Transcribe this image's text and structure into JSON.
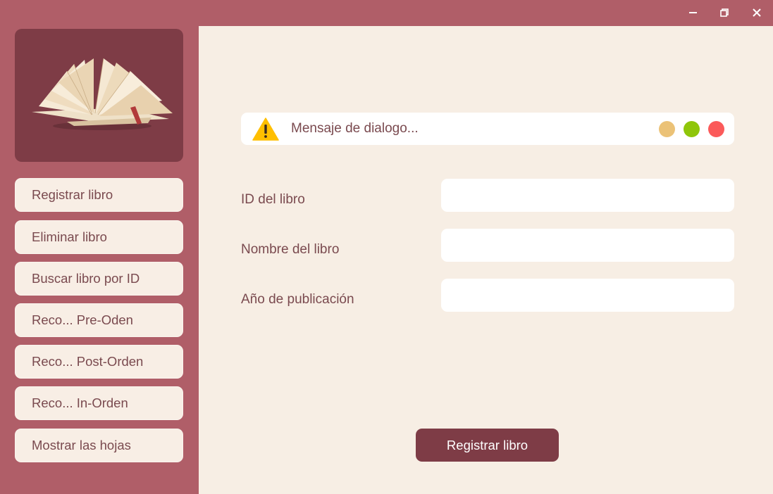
{
  "window": {
    "controls": [
      "minimize-icon",
      "maximize-icon",
      "close-icon"
    ]
  },
  "sidebar": {
    "logo": "open-book-icon",
    "items": [
      {
        "label": "Registrar libro"
      },
      {
        "label": "Eliminar libro"
      },
      {
        "label": "Buscar libro por ID"
      },
      {
        "label": "Reco... Pre-Oden"
      },
      {
        "label": "Reco... Post-Orden"
      },
      {
        "label": "Reco... In-Orden"
      },
      {
        "label": "Mostrar las hojas"
      }
    ]
  },
  "message": {
    "icon": "warning-icon",
    "text": "Mensaje de dialogo...",
    "dots": [
      "#ebc277",
      "#8fc60a",
      "#fb5a5a"
    ]
  },
  "form": {
    "fields": [
      {
        "label": "ID del libro",
        "value": ""
      },
      {
        "label": "Nombre del libro",
        "value": ""
      },
      {
        "label": "Año de publicación",
        "value": ""
      }
    ],
    "submit_label": "Registrar libro"
  },
  "colors": {
    "sidebar_bg": "#b05e68",
    "accent_dark": "#7e3c46",
    "content_bg": "#f7eee4",
    "text": "#7a4a4f"
  }
}
